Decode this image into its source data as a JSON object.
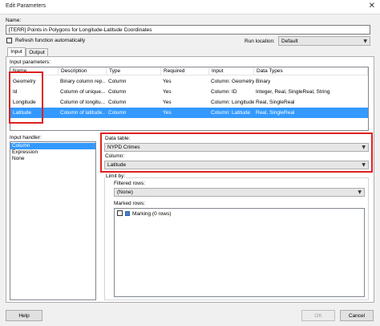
{
  "window": {
    "title": "Edit Parameters",
    "close_glyph": "✕"
  },
  "name": {
    "label": "Name:",
    "value": "[TERR] Points in Polygons for Longitude-Latitude Coordinates"
  },
  "refresh": {
    "label": "Refresh function automatically",
    "checked": false
  },
  "run_location": {
    "label": "Run location:",
    "value": "Default"
  },
  "tabs": [
    {
      "label": "Input"
    },
    {
      "label": "Output"
    }
  ],
  "input_parameters": {
    "label": "Input parameters:",
    "columns": [
      "Name",
      "Description",
      "Type",
      "Required",
      "Input",
      "Data Types"
    ],
    "rows": [
      {
        "name": "Geometry",
        "description": "Binary column rep...",
        "type": "Column",
        "required": "Yes",
        "input": "Column: Geometry",
        "data_types": "Binary",
        "selected": false
      },
      {
        "name": "Id",
        "description": "Column of unique...",
        "type": "Column",
        "required": "Yes",
        "input": "Column: ID",
        "data_types": "Integer, Real, SingleReal, String",
        "selected": false
      },
      {
        "name": "Longitude",
        "description": "Column of longitu...",
        "type": "Column",
        "required": "Yes",
        "input": "Column: Longitude",
        "data_types": "Real, SingleReal",
        "selected": false
      },
      {
        "name": "Latitude",
        "description": "Column of latitude...",
        "type": "Column",
        "required": "Yes",
        "input": "Column: Latitude",
        "data_types": "Real, SingleReal",
        "selected": true
      }
    ]
  },
  "input_handler": {
    "label": "Input handler:",
    "items": [
      {
        "label": "Column",
        "selected": true
      },
      {
        "label": "Expression",
        "selected": false
      },
      {
        "label": "None",
        "selected": false
      }
    ]
  },
  "data_table": {
    "label": "Data table:",
    "value": "NYPD Crimes"
  },
  "column": {
    "label": "Column:",
    "value": "Latitude"
  },
  "limit_by": {
    "label": "Limit by:",
    "filtered_rows": {
      "label": "Filtered rows:",
      "value": "(None)"
    },
    "marked_rows": {
      "label": "Marked rows:",
      "items": [
        {
          "label": "Marking (0 rows)",
          "checked": false,
          "color": "#4a7fd4"
        }
      ]
    }
  },
  "buttons": {
    "help": "Help",
    "ok": "OK",
    "cancel": "Cancel"
  },
  "colors": {
    "selection": "#3399ff",
    "highlight_box": "#e02020"
  }
}
